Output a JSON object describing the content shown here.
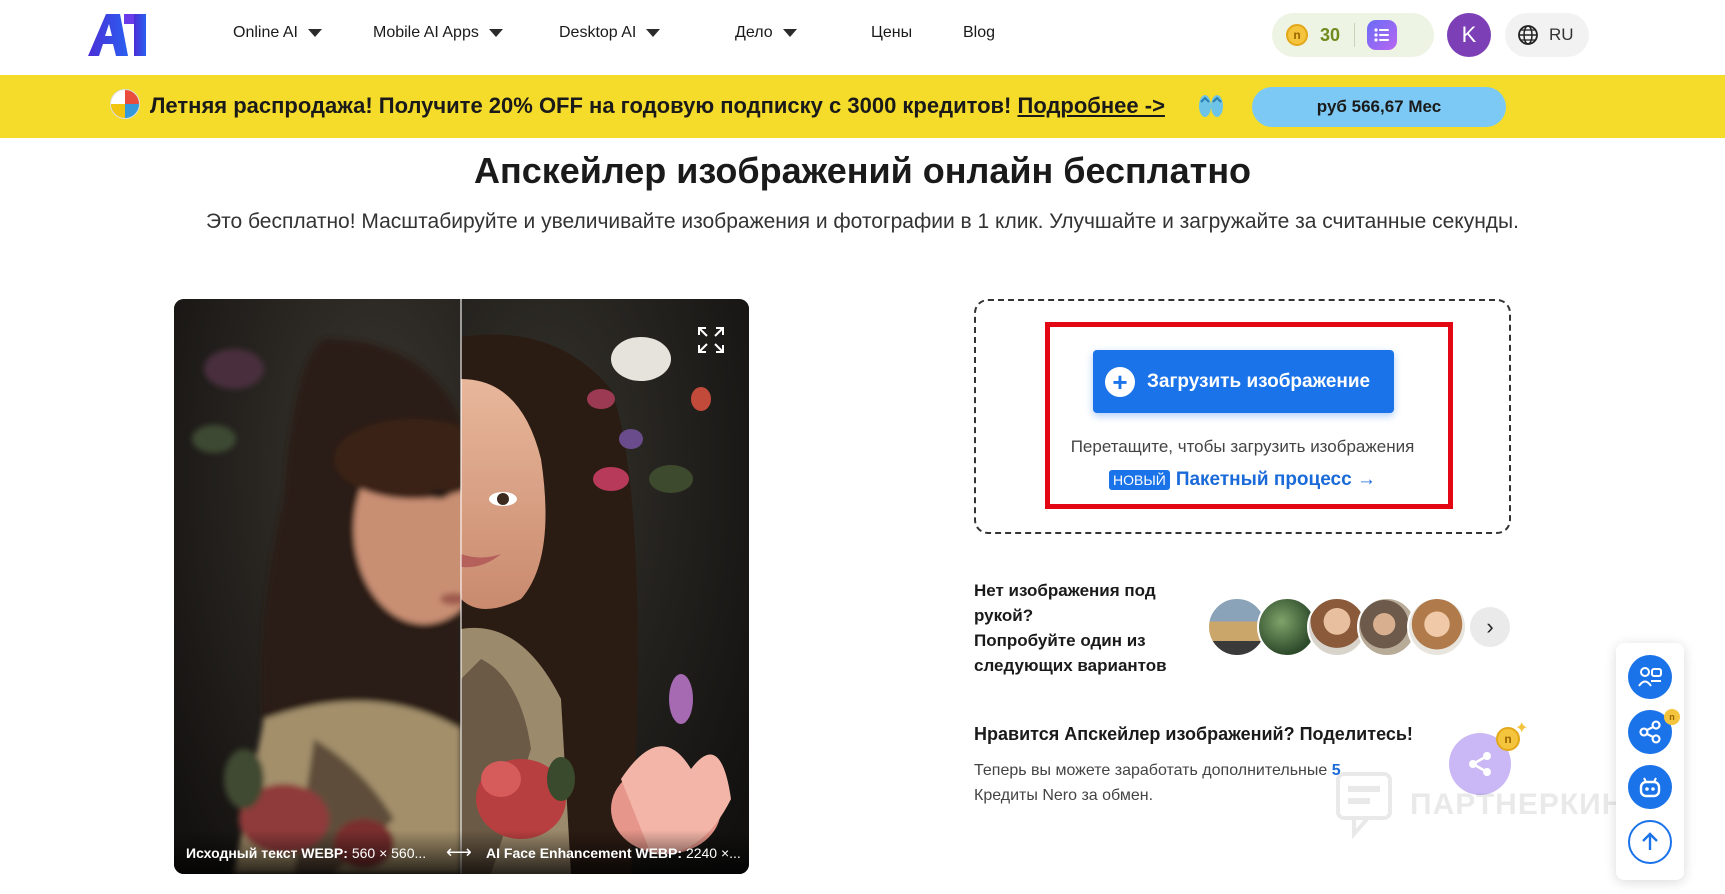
{
  "header": {
    "logo_text": "AI",
    "nav": [
      {
        "label": "Online AI",
        "has_dropdown": true
      },
      {
        "label": "Mobile AI Apps",
        "has_dropdown": true
      },
      {
        "label": "Desktop AI",
        "has_dropdown": true
      },
      {
        "label": "Дело",
        "has_dropdown": true
      },
      {
        "label": "Цены",
        "has_dropdown": false
      },
      {
        "label": "Blog",
        "has_dropdown": false
      }
    ],
    "credits": "30",
    "coin_glyph": "n",
    "avatar_initial": "K",
    "language": "RU"
  },
  "promo": {
    "text": "Летняя распродажа! Получите 20% OFF на годовую подписку с 3000 кредитов!",
    "link": "Подробнее ->",
    "price_button": "руб 566,67 Mес"
  },
  "hero": {
    "title": "Апскейлер изображений онлайн бесплатно",
    "subtitle": "Это бесплатно! Масштабируйте и увеличивайте изображения и фотографии в 1 клик. Улучшайте и загружайте за считанные секунды."
  },
  "comparison": {
    "left_label": "Исходный текст WEBP:",
    "left_value": "560 × 560...",
    "arrows": "⟷",
    "right_label": "AI Face Enhancement WEBP:",
    "right_value": "2240 ×..."
  },
  "upload": {
    "button_label": "Загрузить изображение",
    "drag_hint": "Перетащите, чтобы загрузить изображения",
    "new_badge": "НОВЫЙ",
    "batch_link": "Пакетный процесс →"
  },
  "samples": {
    "line1": "Нет изображения под рукой?",
    "line2": "Попробуйте один из следующих вариантов",
    "next_glyph": "›"
  },
  "share": {
    "title": "Нравится Апскейлер изображений? Поделитесь!",
    "desc_before": "Теперь вы можете заработать дополнительные",
    "desc_number": "5",
    "desc_after": "Кредиты Nero за обмен."
  },
  "watermark": "ПАРТНЕРКИН",
  "colors": {
    "accent": "#1a73e8",
    "promo_bg": "#f5dc2a",
    "highlight": "#e30613",
    "avatar": "#7d3fb6"
  }
}
